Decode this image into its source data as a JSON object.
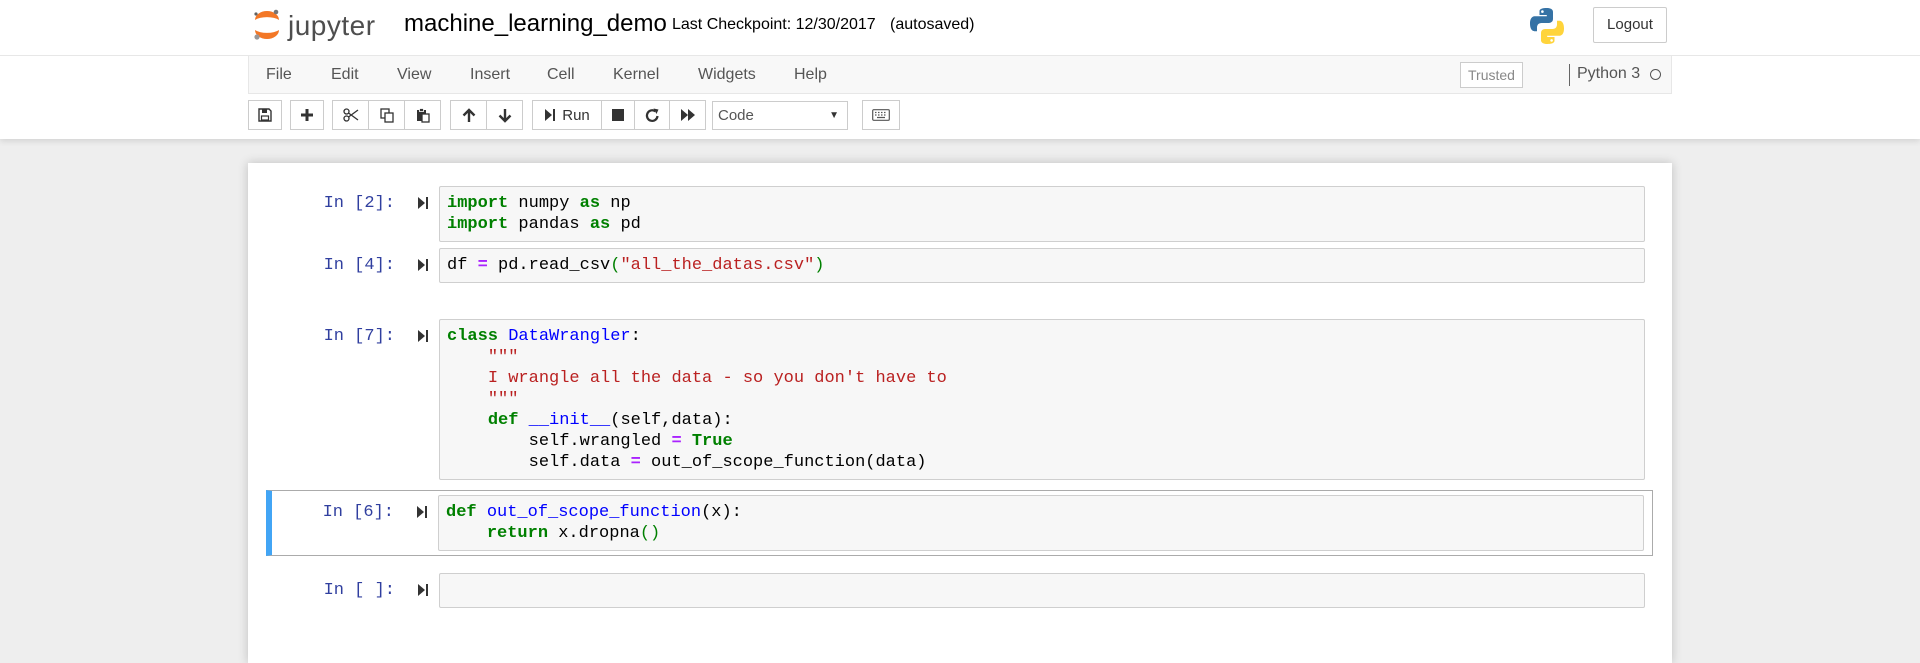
{
  "header": {
    "logo_text": "jupyter",
    "notebook_name": "machine_learning_demo",
    "checkpoint": "Last Checkpoint: 12/30/2017",
    "autosave": "(autosaved)",
    "logout_label": "Logout"
  },
  "menu": {
    "items": [
      "File",
      "Edit",
      "View",
      "Insert",
      "Cell",
      "Kernel",
      "Widgets",
      "Help"
    ],
    "trusted_label": "Trusted",
    "kernel_name": "Python 3"
  },
  "toolbar": {
    "run_label": "Run",
    "cell_type": "Code"
  },
  "cells": [
    {
      "prompt": "In [2]:",
      "lines": [
        [
          {
            "t": "import",
            "c": "kw"
          },
          {
            "t": " numpy "
          },
          {
            "t": "as",
            "c": "kw"
          },
          {
            "t": " np"
          }
        ],
        [
          {
            "t": "import",
            "c": "kw"
          },
          {
            "t": " pandas "
          },
          {
            "t": "as",
            "c": "kw"
          },
          {
            "t": " pd"
          }
        ]
      ]
    },
    {
      "prompt": "In [4]:",
      "lines": [
        [
          {
            "t": "df "
          },
          {
            "t": "=",
            "c": "op"
          },
          {
            "t": " pd.read_csv"
          },
          {
            "t": "(",
            "c": "paren"
          },
          {
            "t": "\"all_the_datas.csv\"",
            "c": "str"
          },
          {
            "t": ")",
            "c": "paren"
          }
        ]
      ]
    },
    {
      "prompt": "In [7]:",
      "lines": [
        [
          {
            "t": "class",
            "c": "kw"
          },
          {
            "t": " "
          },
          {
            "t": "DataWrangler",
            "c": "def"
          },
          {
            "t": ":"
          }
        ],
        [
          {
            "t": "    "
          },
          {
            "t": "\"\"\"",
            "c": "docstr"
          }
        ],
        [
          {
            "t": "    "
          },
          {
            "t": "I wrangle all the data - so you don't have to",
            "c": "docstr"
          }
        ],
        [
          {
            "t": "    "
          },
          {
            "t": "\"\"\"",
            "c": "docstr"
          }
        ],
        [
          {
            "t": "    "
          },
          {
            "t": "def",
            "c": "kw"
          },
          {
            "t": " "
          },
          {
            "t": "__init__",
            "c": "def"
          },
          {
            "t": "(self,data):"
          }
        ],
        [
          {
            "t": "        self.wrangled "
          },
          {
            "t": "=",
            "c": "op"
          },
          {
            "t": " "
          },
          {
            "t": "True",
            "c": "kw"
          }
        ],
        [
          {
            "t": "        self.data "
          },
          {
            "t": "=",
            "c": "op"
          },
          {
            "t": " out_of_scope_function(data)"
          }
        ]
      ]
    },
    {
      "prompt": "In [6]:",
      "selected": true,
      "lines": [
        [
          {
            "t": "def",
            "c": "kw"
          },
          {
            "t": " "
          },
          {
            "t": "out_of_scope_function",
            "c": "def"
          },
          {
            "t": "(x):"
          }
        ],
        [
          {
            "t": "    "
          },
          {
            "t": "return",
            "c": "kw"
          },
          {
            "t": " x.dropna"
          },
          {
            "t": "()",
            "c": "paren"
          }
        ]
      ]
    },
    {
      "prompt": "In [ ]:",
      "lines": [
        []
      ]
    }
  ]
}
